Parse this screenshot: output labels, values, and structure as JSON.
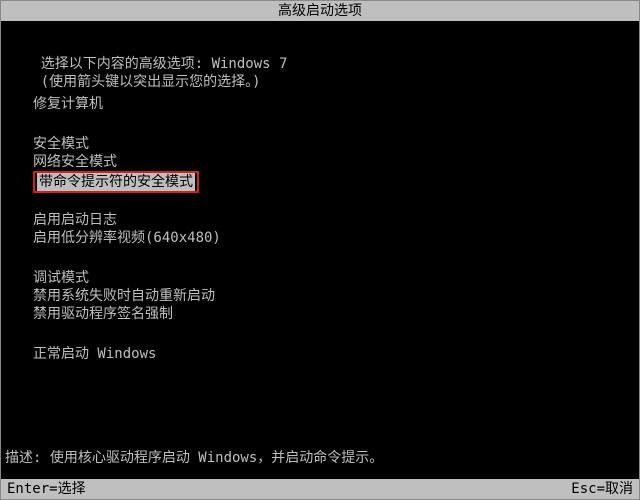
{
  "title": "高级启动选项",
  "prompt_prefix": "选择以下内容的高级选项: ",
  "os_name": "Windows 7",
  "hint": "(使用箭头键以突出显示您的选择。)",
  "groups": [
    {
      "items": [
        {
          "label": "修复计算机",
          "selected": false,
          "highlight": false
        }
      ]
    },
    {
      "items": [
        {
          "label": "安全模式",
          "selected": false,
          "highlight": false
        },
        {
          "label": "网络安全模式",
          "selected": false,
          "highlight": false
        },
        {
          "label": "带命令提示符的安全模式",
          "selected": true,
          "highlight": true
        }
      ]
    },
    {
      "items": [
        {
          "label": "启用启动日志",
          "selected": false,
          "highlight": false
        },
        {
          "label": "启用低分辨率视频(640x480)",
          "selected": false,
          "highlight": false
        }
      ]
    },
    {
      "items": [
        {
          "label": "调试模式",
          "selected": false,
          "highlight": false
        },
        {
          "label": "禁用系统失败时自动重新启动",
          "selected": false,
          "highlight": false
        },
        {
          "label": "禁用驱动程序签名强制",
          "selected": false,
          "highlight": false
        }
      ]
    },
    {
      "items": [
        {
          "label": "正常启动 Windows",
          "selected": false,
          "highlight": false
        }
      ]
    }
  ],
  "description_label": "描述: ",
  "description_text": "使用核心驱动程序启动 Windows，并启动命令提示。",
  "footer": {
    "enter": "Enter=选择",
    "esc": "Esc=取消"
  }
}
